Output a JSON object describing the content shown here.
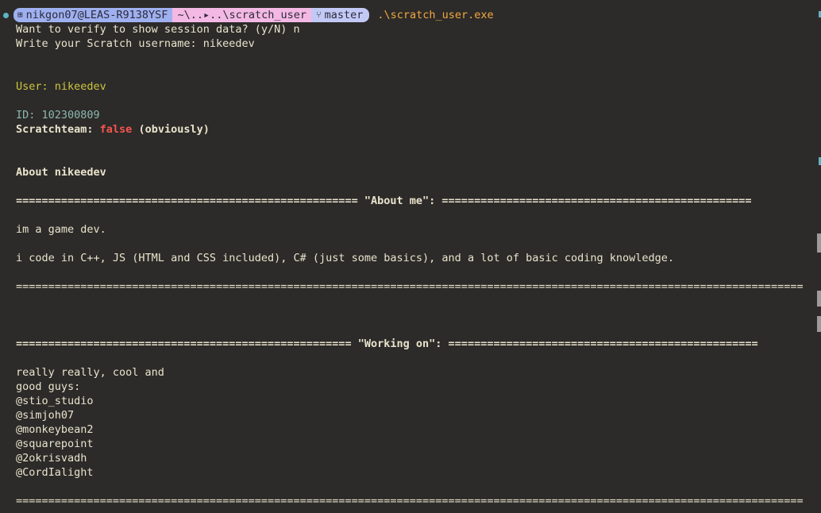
{
  "prompt": {
    "user_host": "nikgon07@LEAS-R9138YSF",
    "path": "~\\..▸..\\scratch_user",
    "branch": "master",
    "command": ".\\scratch_user.exe",
    "user_icon": "windows-icon",
    "branch_icon": "git-branch-icon"
  },
  "session": {
    "verify_question": "Want to verify to show session data? (y/N) n",
    "username_prompt": "Write your Scratch username: nikeedev"
  },
  "profile": {
    "user_line": "User: nikeedev",
    "id_line": "ID: 102300809",
    "scratchteam_label": "Scratchteam: ",
    "scratchteam_value": "false",
    "scratchteam_note": " (obviously)",
    "about_heading": "About nikeedev"
  },
  "about_me": {
    "header": "===================================================== \"About me\": ================================================",
    "line1": "im a game dev.",
    "line2": "i code in C++, JS (HTML and CSS included), C# (just some basics), and a lot of basic coding knowledge.",
    "footer": "=========================================================================================================================="
  },
  "working_on": {
    "header": "==================================================== \"Working on\": ================================================",
    "lines": [
      "really really, cool and",
      "good guys:",
      "@stio_studio",
      "@simjoh07",
      "@monkeybean2",
      "@squarepoint",
      "@2okrisvadh",
      "@CordIalight"
    ],
    "footer": "=========================================================================================================================="
  },
  "colors": {
    "background": "#2c2b29",
    "text": "#eae3cd",
    "yellow": "#cfc53f",
    "teal": "#8fb7b0",
    "red": "#f5544f",
    "command": "#f4a83f"
  }
}
